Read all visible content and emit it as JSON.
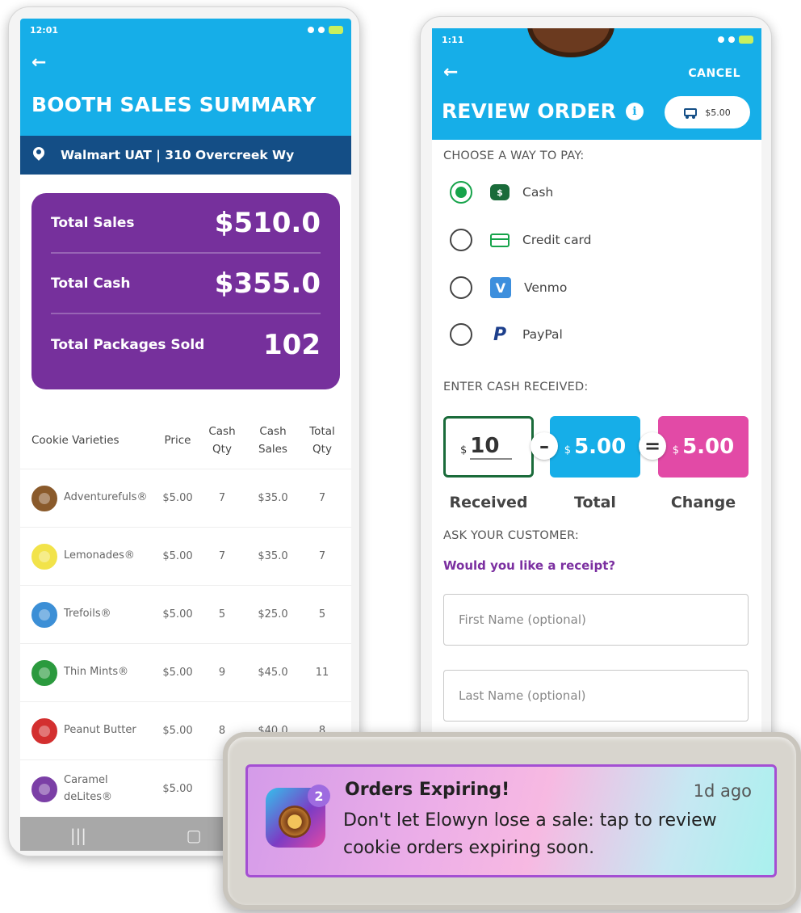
{
  "booth_summary": {
    "status_time": "12:01",
    "title": "BOOTH SALES SUMMARY",
    "location": "Walmart UAT | 310 Overcreek Wy",
    "totals": [
      {
        "label": "Total Sales",
        "value": "$510.0"
      },
      {
        "label": "Total Cash",
        "value": "$355.0"
      },
      {
        "label": "Total Packages Sold",
        "value": "102"
      }
    ],
    "table_headers": {
      "variety": "Cookie Varieties",
      "price": "Price",
      "cash_qty": "Cash Qty",
      "cash_sales": "Cash Sales",
      "total_qty": "Total Qty"
    },
    "rows": [
      {
        "name": "Adventurefuls®",
        "color": "#8a5a2b",
        "price": "$5.00",
        "cash_qty": "7",
        "cash_sales": "$35.0",
        "total_qty": "7"
      },
      {
        "name": "Lemonades®",
        "color": "#f2e34a",
        "price": "$5.00",
        "cash_qty": "7",
        "cash_sales": "$35.0",
        "total_qty": "7"
      },
      {
        "name": "Trefoils®",
        "color": "#3c8fd6",
        "price": "$5.00",
        "cash_qty": "5",
        "cash_sales": "$25.0",
        "total_qty": "5"
      },
      {
        "name": "Thin Mints®",
        "color": "#2b9a3e",
        "price": "$5.00",
        "cash_qty": "9",
        "cash_sales": "$45.0",
        "total_qty": "11"
      },
      {
        "name": "Peanut Butter",
        "color": "#d32f2f",
        "price": "$5.00",
        "cash_qty": "8",
        "cash_sales": "$40.0",
        "total_qty": "8"
      },
      {
        "name": "Caramel deLites®",
        "color": "#7b3fa6",
        "price": "$5.00",
        "cash_qty": "",
        "cash_sales": "",
        "total_qty": ""
      }
    ]
  },
  "review_order": {
    "status_time": "1:11",
    "cancel": "CANCEL",
    "title": "REVIEW ORDER",
    "cart_total": "$5.00",
    "choose_pay_label": "CHOOSE A WAY TO PAY:",
    "payment_methods": [
      {
        "label": "Cash",
        "selected": true
      },
      {
        "label": "Credit card",
        "selected": false
      },
      {
        "label": "Venmo",
        "selected": false
      },
      {
        "label": "PayPal",
        "selected": false
      }
    ],
    "enter_cash_label": "ENTER CASH RECEIVED:",
    "currency": "$",
    "received_value": "10",
    "total_value": "5.00",
    "change_value": "5.00",
    "received_label": "Received",
    "total_label": "Total",
    "change_label": "Change",
    "ask_customer_label": "ASK YOUR CUSTOMER:",
    "receipt_question": "Would you like a receipt?",
    "first_name_placeholder": "First Name (optional)",
    "last_name_placeholder": "Last Name (optional)"
  },
  "notification": {
    "badge": "2",
    "title": "Orders Expiring!",
    "time": "1d ago",
    "body": "Don't let Elowyn lose a sale: tap to review cookie orders expiring soon."
  }
}
